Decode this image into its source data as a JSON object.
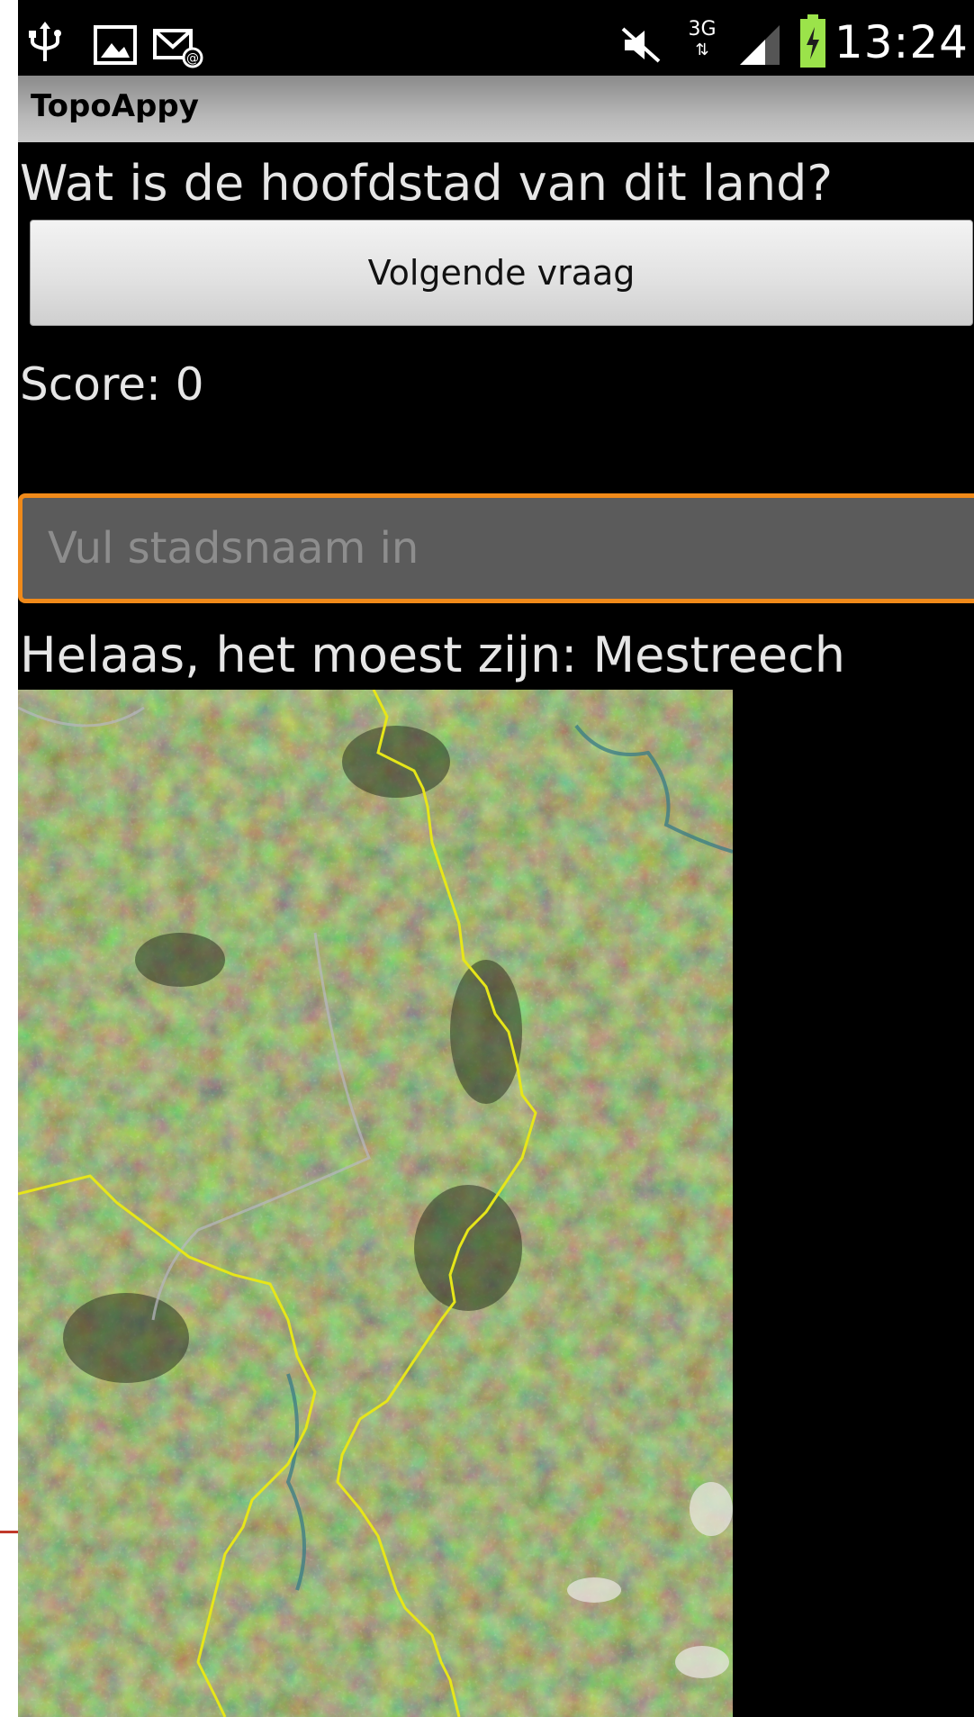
{
  "status_bar": {
    "time": "13:24",
    "network": "3G",
    "icons": [
      "usb-icon",
      "image-icon",
      "email-icon",
      "mute-icon",
      "network-3g-icon",
      "signal-icon",
      "battery-charging-icon"
    ]
  },
  "app": {
    "title": "TopoAppy"
  },
  "quiz": {
    "question": "Wat is de hoofdstad van dit land?",
    "next_button_label": "Volgende vraag",
    "score_text": "Score: 0",
    "input": {
      "value": "",
      "placeholder": "Vul stadsnaam in"
    },
    "feedback": "Helaas, het moest zijn: Mestreech"
  },
  "colors": {
    "background": "#000000",
    "input_focus_border": "#f08a1a",
    "border_line": "#e6e619"
  }
}
